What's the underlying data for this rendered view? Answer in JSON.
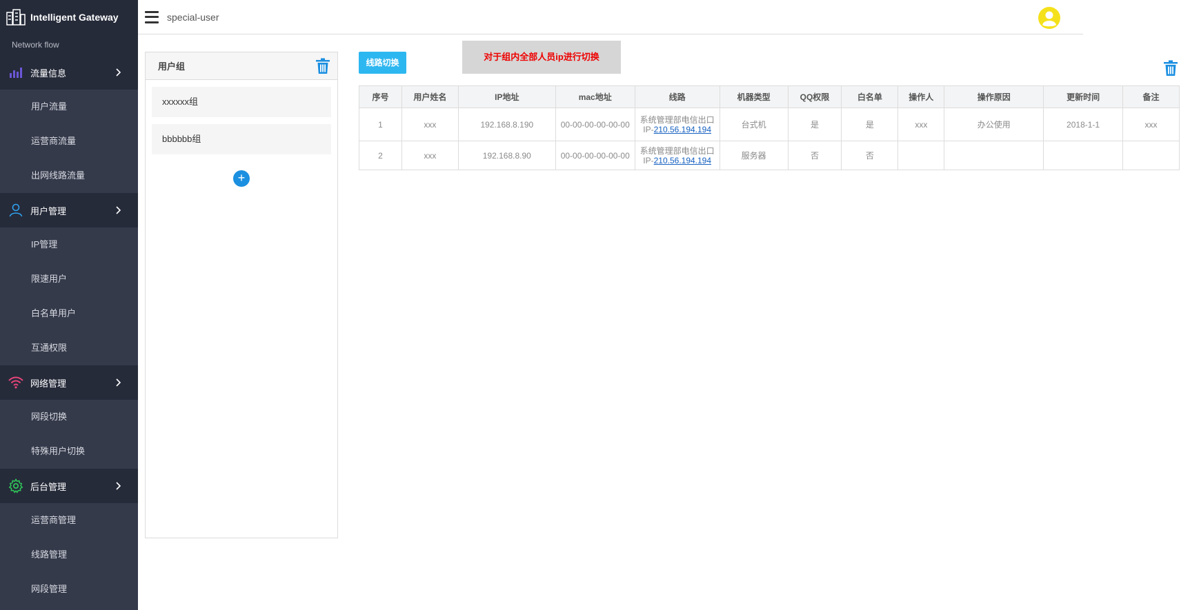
{
  "brand": {
    "title": "Intelligent Gateway",
    "section_label": "Network flow"
  },
  "sidebar": {
    "groups": [
      {
        "label": "流量信息",
        "icon": "bar-chart-icon",
        "color": "#6b57d6",
        "items": [
          {
            "label": "用户流量"
          },
          {
            "label": "运营商流量"
          },
          {
            "label": "出网线路流量"
          }
        ]
      },
      {
        "label": "用户管理",
        "icon": "user-icon",
        "color": "#2fa3f0",
        "items": [
          {
            "label": "IP管理"
          },
          {
            "label": "限速用户"
          },
          {
            "label": "白名单用户"
          },
          {
            "label": "互通权限"
          }
        ]
      },
      {
        "label": "网络管理",
        "icon": "wifi-icon",
        "color": "#e8457a",
        "items": [
          {
            "label": "网段切换"
          },
          {
            "label": "特殊用户切换"
          }
        ]
      },
      {
        "label": "后台管理",
        "icon": "gear-icon",
        "color": "#2fcf5a",
        "items": [
          {
            "label": "运营商管理"
          },
          {
            "label": "线路管理"
          },
          {
            "label": "网段管理"
          }
        ]
      }
    ]
  },
  "topbar": {
    "page_name": "special-user"
  },
  "group_panel": {
    "title": "用户组",
    "items": [
      {
        "label": "xxxxxx组"
      },
      {
        "label": "bbbbbb组"
      }
    ],
    "add_label": "+"
  },
  "main": {
    "switch_button": "线路切换",
    "tooltip": "对于组内全部人员ip进行切换",
    "columns": [
      "序号",
      "用户姓名",
      "IP地址",
      "mac地址",
      "线路",
      "机器类型",
      "QQ权限",
      "白名单",
      "操作人",
      "操作原因",
      "更新时间",
      "备注"
    ],
    "rows": [
      {
        "no": "1",
        "name": "xxx",
        "ip": "192.168.8.190",
        "mac": "00-00-00-00-00-00",
        "line_name": "系统管理部电信出口",
        "line_prefix": "IP-",
        "line_ip": "210.56.194.194",
        "machine": "台式机",
        "qq": "是",
        "whitelist": "是",
        "operator": "xxx",
        "reason": "办公使用",
        "updated": "2018-1-1",
        "note": "xxx"
      },
      {
        "no": "2",
        "name": "xxx",
        "ip": "192.168.8.90",
        "mac": "00-00-00-00-00-00",
        "line_name": "系统管理部电信出口",
        "line_prefix": "IP-",
        "line_ip": "210.56.194.194",
        "machine": "服务器",
        "qq": "否",
        "whitelist": "否",
        "operator": "",
        "reason": "",
        "updated": "",
        "note": ""
      }
    ]
  },
  "colors": {
    "sidebar_bg": "#353a4b",
    "sidebar_dark": "#262b3a",
    "accent": "#1b8fe0",
    "button": "#2db7f0",
    "tooltip_text": "#e00000",
    "avatar": "#f5e11b"
  }
}
